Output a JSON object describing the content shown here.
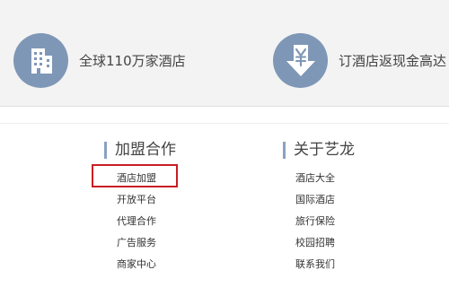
{
  "features": [
    {
      "label": "全球110万家酒店",
      "icon": "hotel-building-icon"
    },
    {
      "label": "订酒店返现金高达",
      "icon": "yen-download-icon"
    }
  ],
  "columns": [
    {
      "heading": "加盟合作",
      "items": [
        "酒店加盟",
        "开放平台",
        "代理合作",
        "广告服务",
        "商家中心"
      ]
    },
    {
      "heading": "关于艺龙",
      "items": [
        "酒店大全",
        "国际酒店",
        "旅行保险",
        "校园招聘",
        "联系我们"
      ]
    }
  ],
  "colors": {
    "band_background": "#f3f3f3",
    "icon_circle": "#7f97b6",
    "heading_bar": "#8aa2c0",
    "highlight_border": "#c81d25"
  }
}
